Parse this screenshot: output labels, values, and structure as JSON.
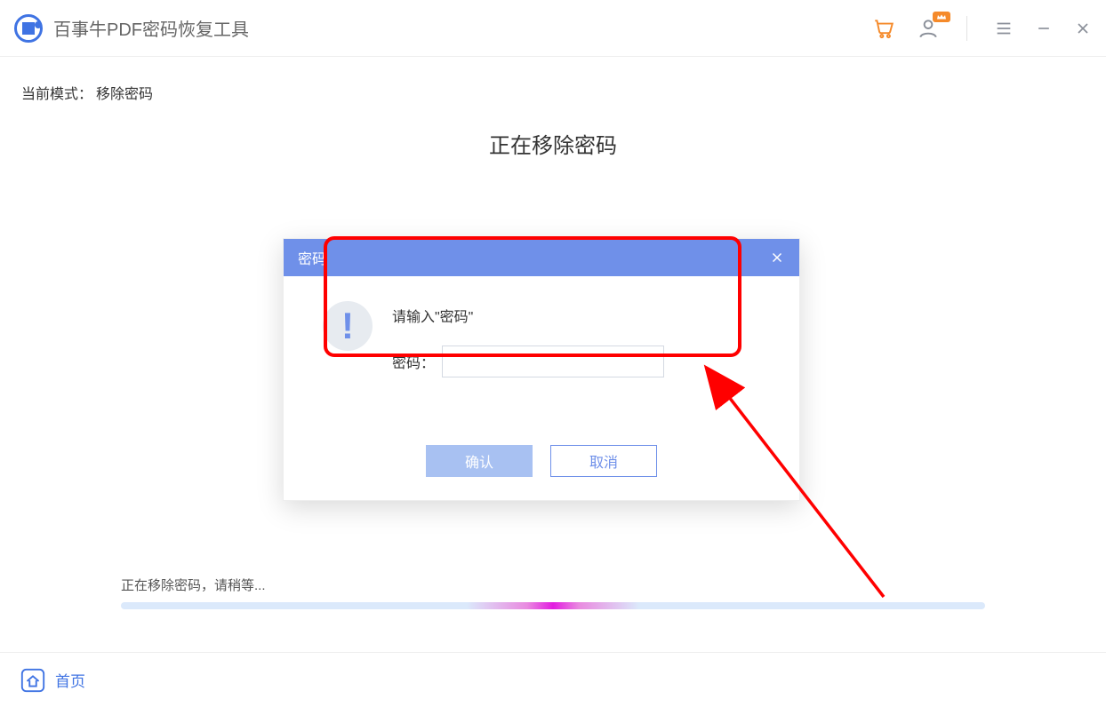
{
  "titlebar": {
    "app_title": "百事牛PDF密码恢复工具"
  },
  "content": {
    "mode_label": "当前模式：",
    "mode_value": "移除密码",
    "heading": "正在移除密码",
    "status": "正在移除密码，请稍等..."
  },
  "dialog": {
    "title": "密码",
    "prompt": "请输入\"密码\"",
    "field_label": "密码：",
    "input_value": "",
    "confirm": "确认",
    "cancel": "取消"
  },
  "footer": {
    "home": "首页"
  }
}
